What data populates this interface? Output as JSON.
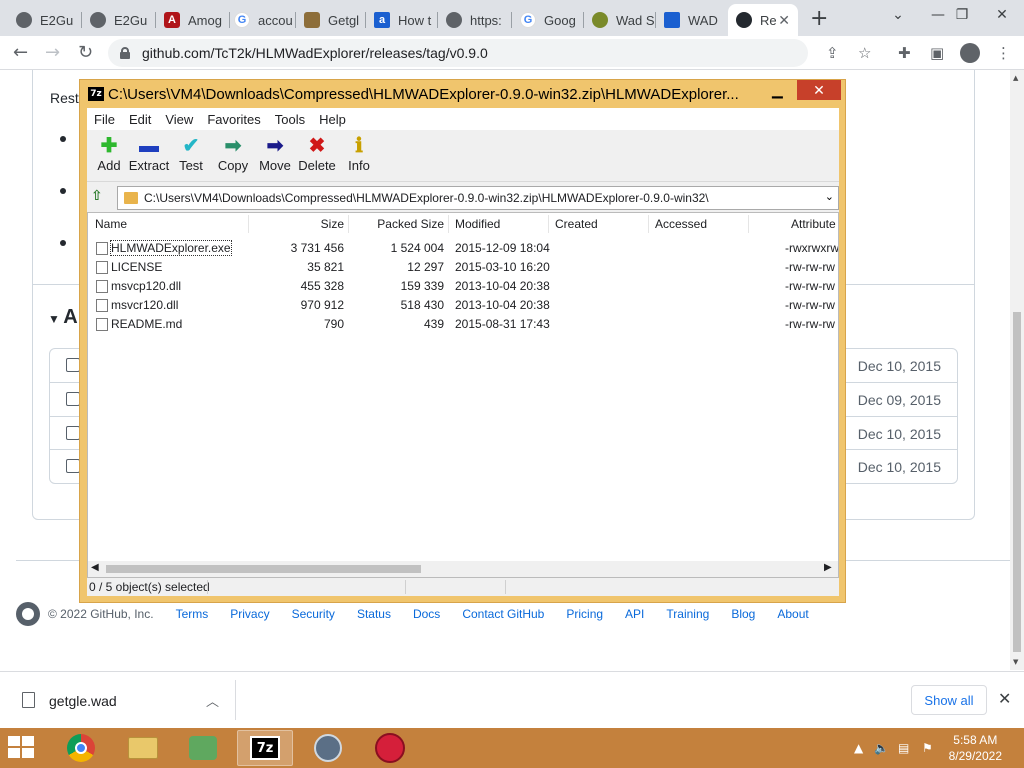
{
  "browser": {
    "tabs": [
      {
        "label": "E2Gu",
        "icon": "globe-icon"
      },
      {
        "label": "E2Gu",
        "icon": "globe-icon"
      },
      {
        "label": "Amog",
        "icon": "amog-icon"
      },
      {
        "label": "accou",
        "icon": "google-icon"
      },
      {
        "label": "Getgl",
        "icon": "getgle-icon"
      },
      {
        "label": "How t",
        "icon": "a-icon"
      },
      {
        "label": "https:",
        "icon": "globe-icon"
      },
      {
        "label": "Goog",
        "icon": "google-icon"
      },
      {
        "label": "Wad S",
        "icon": "wad-icon"
      },
      {
        "label": "WAD",
        "icon": "doc-icon"
      },
      {
        "label": "Re",
        "icon": "github-icon"
      }
    ],
    "new_tab": "+",
    "url": "github.com/TcT2k/HLMWadExplorer/releases/tag/v0.9.0"
  },
  "github_page": {
    "rest_text": "Rest",
    "assets_label": "A",
    "asset_dates": [
      "Dec 10, 2015",
      "Dec 09, 2015",
      "Dec 10, 2015",
      "Dec 10, 2015"
    ],
    "footer": {
      "copyright": "© 2022 GitHub, Inc.",
      "links": [
        "Terms",
        "Privacy",
        "Security",
        "Status",
        "Docs",
        "Contact GitHub",
        "Pricing",
        "API",
        "Training",
        "Blog",
        "About"
      ]
    }
  },
  "sevenzip": {
    "title": "C:\\Users\\VM4\\Downloads\\Compressed\\HLMWADExplorer-0.9.0-win32.zip\\HLMWADExplorer...",
    "logo": "7z",
    "menu": [
      "File",
      "Edit",
      "View",
      "Favorites",
      "Tools",
      "Help"
    ],
    "toolbar": [
      {
        "label": "Add",
        "icon": "plus-icon",
        "color": "#2eb82e"
      },
      {
        "label": "Extract",
        "icon": "minus-icon",
        "color": "#1f3fbf"
      },
      {
        "label": "Test",
        "icon": "check-icon",
        "color": "#24b6c7"
      },
      {
        "label": "Copy",
        "icon": "copy-arrow-icon",
        "color": "#2a8f6a"
      },
      {
        "label": "Move",
        "icon": "move-arrow-icon",
        "color": "#1a1a8a"
      },
      {
        "label": "Delete",
        "icon": "x-icon",
        "color": "#d01818"
      },
      {
        "label": "Info",
        "icon": "info-icon",
        "color": "#c8a000"
      }
    ],
    "address": "C:\\Users\\VM4\\Downloads\\Compressed\\HLMWADExplorer-0.9.0-win32.zip\\HLMWADExplorer-0.9.0-win32\\",
    "columns": [
      "Name",
      "Size",
      "Packed Size",
      "Modified",
      "Created",
      "Accessed",
      "Attribute"
    ],
    "files": [
      {
        "name": "HLMWADExplorer.exe",
        "size": "3 731 456",
        "packed": "1 524 004",
        "modified": "2015-12-09 18:04",
        "attr": "-rwxrwxrw"
      },
      {
        "name": "LICENSE",
        "size": "35 821",
        "packed": "12 297",
        "modified": "2015-03-10 16:20",
        "attr": "-rw-rw-rw"
      },
      {
        "name": "msvcp120.dll",
        "size": "455 328",
        "packed": "159 339",
        "modified": "2013-10-04 20:38",
        "attr": "-rw-rw-rw"
      },
      {
        "name": "msvcr120.dll",
        "size": "970 912",
        "packed": "518 430",
        "modified": "2013-10-04 20:38",
        "attr": "-rw-rw-rw"
      },
      {
        "name": "README.md",
        "size": "790",
        "packed": "439",
        "modified": "2015-08-31 17:43",
        "attr": "-rw-rw-rw"
      }
    ],
    "status": "0 / 5 object(s) selected"
  },
  "downloads": {
    "file": "getgle.wad",
    "show_all": "Show all"
  },
  "taskbar": {
    "time": "5:58 AM",
    "date": "8/29/2022",
    "apps": [
      "chrome-icon",
      "file-explorer-icon",
      "people-icon",
      "7zip-icon",
      "app-circle-icon",
      "app-red-icon"
    ]
  }
}
